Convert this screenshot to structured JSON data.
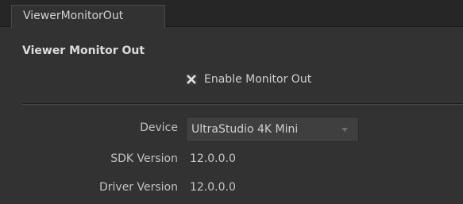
{
  "tabs": [
    {
      "label": "ViewerMonitorOut"
    }
  ],
  "section": {
    "title": "Viewer Monitor Out"
  },
  "enable_monitor_out": {
    "label": "Enable Monitor Out",
    "checked": true,
    "icon": "x-check-icon"
  },
  "fields": {
    "device": {
      "label": "Device",
      "value": "UltraStudio 4K Mini"
    },
    "sdk_version": {
      "label": "SDK Version",
      "value": "12.0.0.0"
    },
    "driver_version": {
      "label": "Driver Version",
      "value": "12.0.0.0"
    }
  },
  "colors": {
    "background": "#323232",
    "tab_strip": "#262626",
    "text": "#c8c8c8",
    "dropdown_bg": "#3f3f3f"
  }
}
